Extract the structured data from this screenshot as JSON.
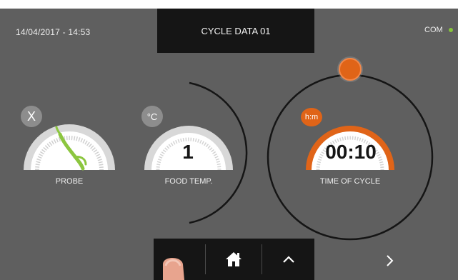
{
  "header": {
    "datetime": "14/04/2017 - 14:53",
    "title": "CYCLE DATA 01",
    "com_label": "COM"
  },
  "gauges": {
    "probe": {
      "label": "PROBE",
      "badge": "X"
    },
    "food_temp": {
      "label": "FOOD TEMP.",
      "badge": "°C",
      "value": "1"
    },
    "time_of_cycle": {
      "label": "TIME OF CYCLE",
      "badge": "h:m",
      "value": "00:10"
    }
  },
  "nav": {
    "home_icon": "home-icon",
    "up_icon": "chevron-up-icon",
    "next_icon": "chevron-right-icon"
  },
  "colors": {
    "background": "#5f5f5f",
    "panel": "#151515",
    "accent": "#e06418",
    "probe_green": "#8cc63f",
    "status_green": "#86c43a"
  }
}
